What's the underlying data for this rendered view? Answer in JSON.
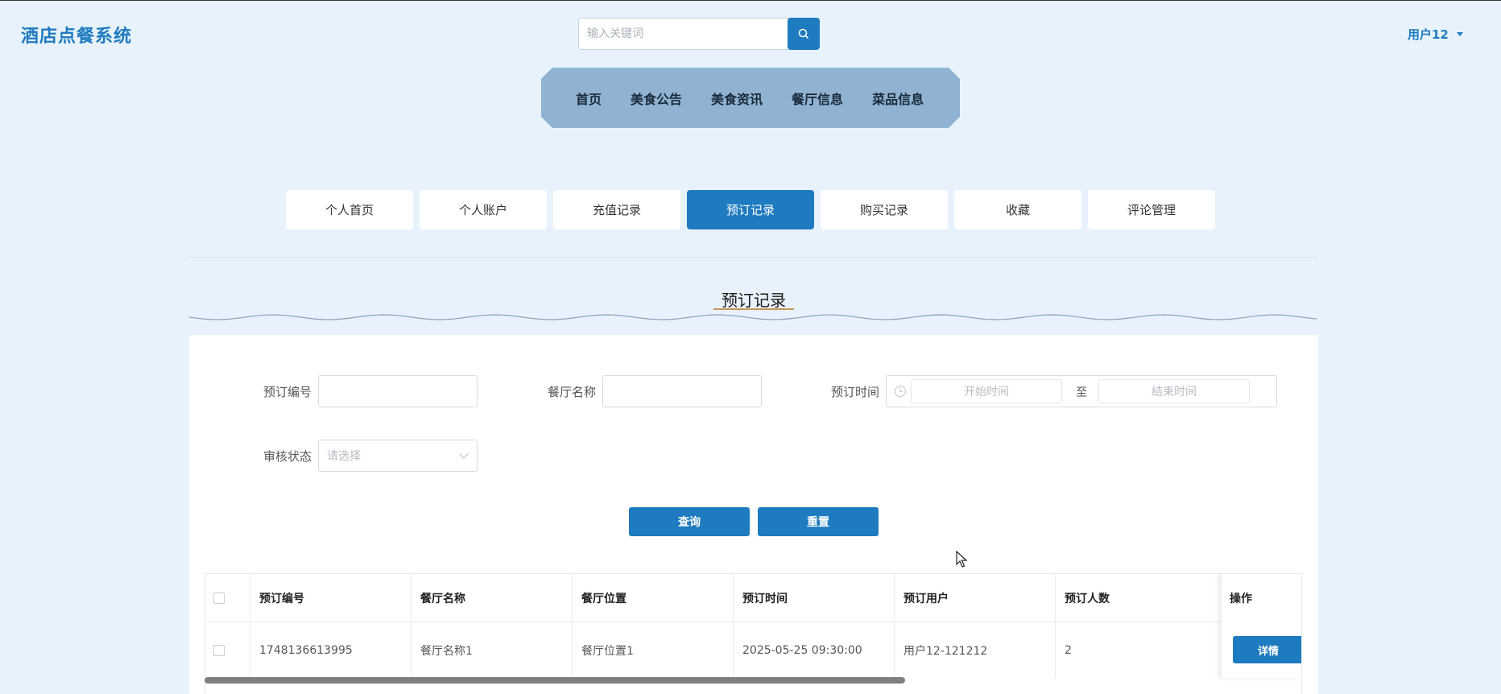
{
  "app": {
    "title": "酒店点餐系统"
  },
  "search": {
    "placeholder": "输入关键词"
  },
  "user": {
    "name": "用户12"
  },
  "main_nav": [
    "首页",
    "美食公告",
    "美食资讯",
    "餐厅信息",
    "菜品信息"
  ],
  "tabs": [
    {
      "label": "个人首页",
      "active": false
    },
    {
      "label": "个人账户",
      "active": false
    },
    {
      "label": "充值记录",
      "active": false
    },
    {
      "label": "预订记录",
      "active": true
    },
    {
      "label": "购买记录",
      "active": false
    },
    {
      "label": "收藏",
      "active": false
    },
    {
      "label": "评论管理",
      "active": false
    }
  ],
  "section": {
    "title": "预订记录"
  },
  "filters": {
    "booking_no_label": "预订编号",
    "booking_no_value": "",
    "restaurant_label": "餐厅名称",
    "restaurant_value": "",
    "time_label": "预订时间",
    "start_placeholder": "开始时间",
    "range_sep": "至",
    "end_placeholder": "结束时间",
    "status_label": "审核状态",
    "status_placeholder": "请选择",
    "query_button": "查询",
    "reset_button": "重置"
  },
  "table": {
    "columns": [
      "预订编号",
      "餐厅名称",
      "餐厅位置",
      "预订时间",
      "预订用户",
      "预订人数"
    ],
    "op_column": "操作",
    "rows": [
      {
        "booking_no": "1748136613995",
        "restaurant": "餐厅名称1",
        "location": "餐厅位置1",
        "time": "2025-05-25 09:30:00",
        "user": "用户12-121212",
        "people": "2",
        "action": "详情"
      }
    ]
  },
  "colors": {
    "primary": "#1e7bbf",
    "nav_bg": "#90b3d3",
    "page_bg": "#e8f2fc"
  }
}
